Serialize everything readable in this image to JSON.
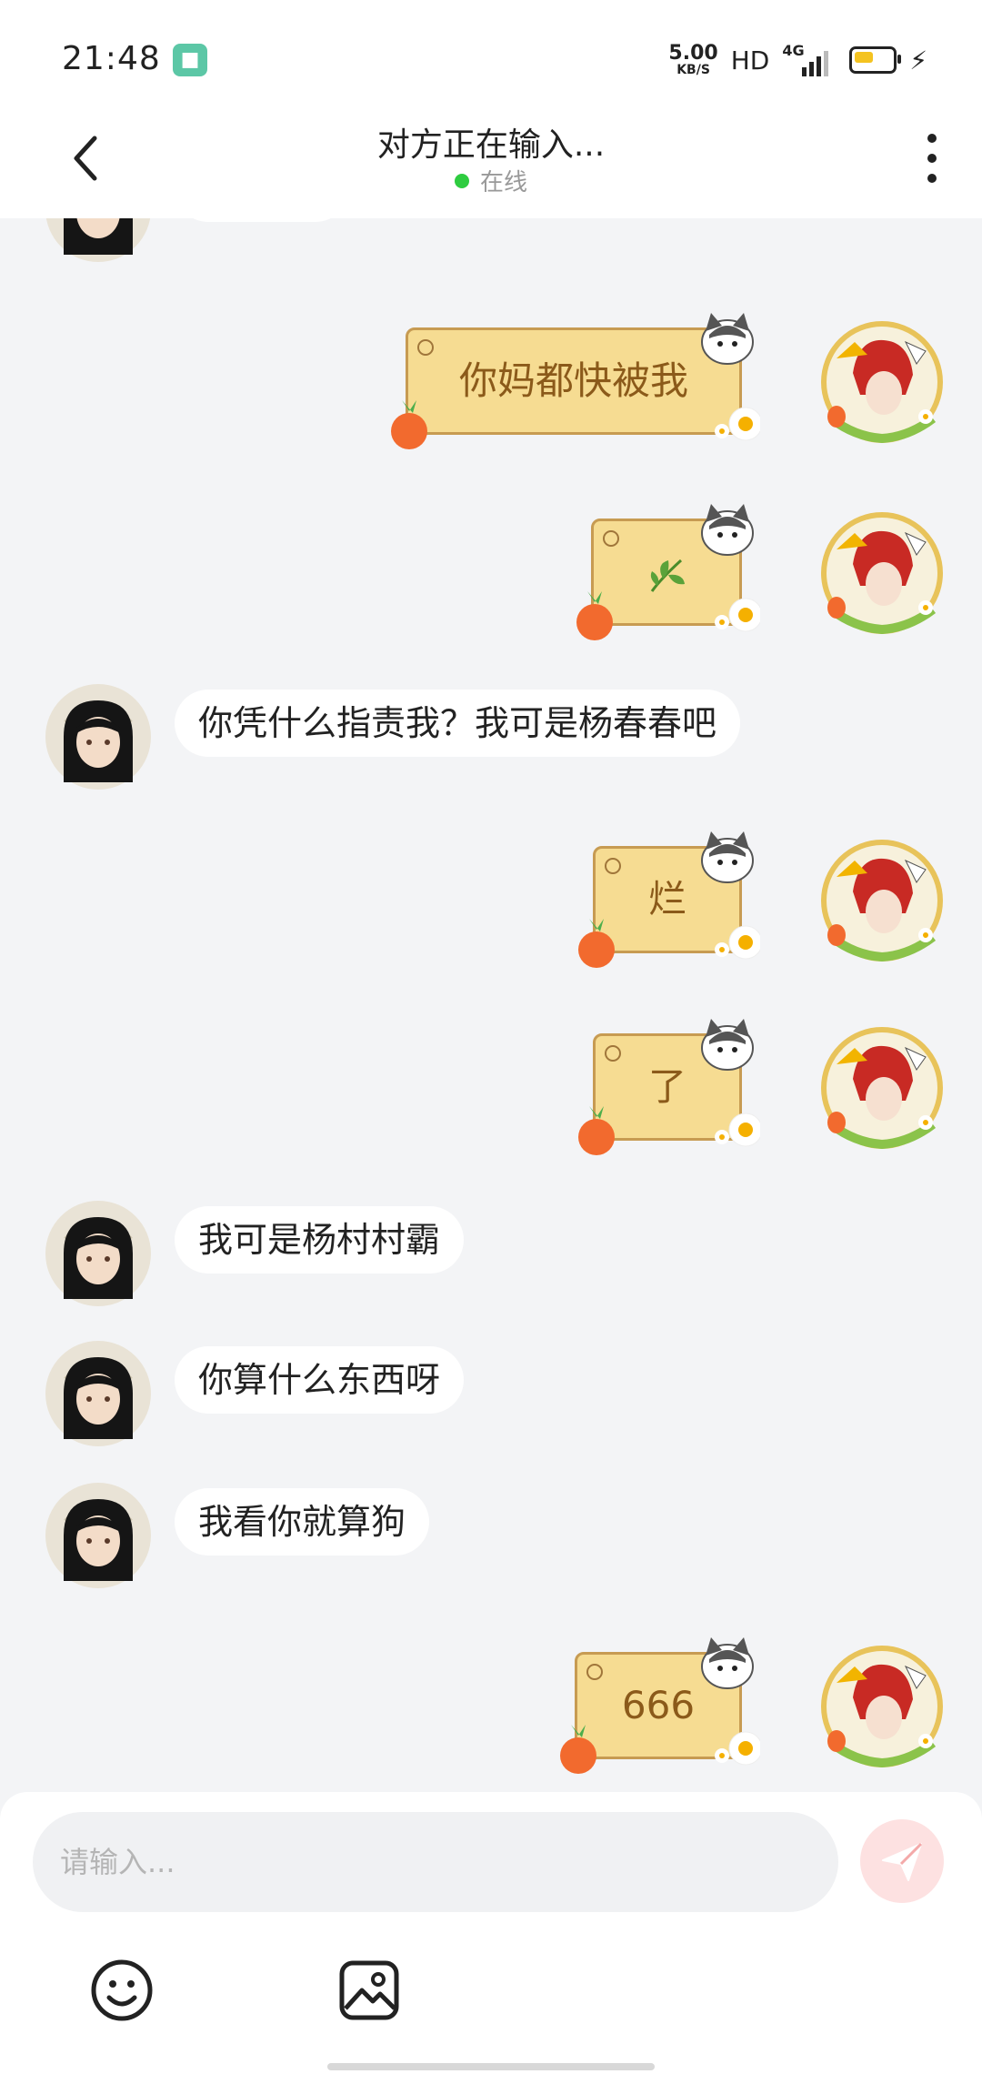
{
  "status_bar": {
    "time": "21:48",
    "net_speed_value": "5.00",
    "net_speed_unit": "KB/S",
    "hd": "HD",
    "network": "4G",
    "battery_level": 0.5,
    "accent_green": "#5cc7a6"
  },
  "header": {
    "title": "对方正在输入...",
    "status": "在线",
    "status_color": "#2ecc40"
  },
  "messages": [
    {
      "side": "left",
      "type": "text",
      "text": ""
    },
    {
      "side": "right",
      "type": "sticker",
      "text": "你妈都快被我"
    },
    {
      "side": "right",
      "type": "sticker",
      "text": "",
      "icon": "leaf-icon"
    },
    {
      "side": "left",
      "type": "text",
      "text": "你凭什么指责我？我可是杨春春吧"
    },
    {
      "side": "right",
      "type": "sticker",
      "text": "烂"
    },
    {
      "side": "right",
      "type": "sticker",
      "text": "了"
    },
    {
      "side": "left",
      "type": "text",
      "text": "我可是杨村村霸"
    },
    {
      "side": "left",
      "type": "text",
      "text": "你算什么东西呀"
    },
    {
      "side": "left",
      "type": "text",
      "text": "我看你就算狗"
    },
    {
      "side": "right",
      "type": "sticker",
      "text": "666"
    }
  ],
  "composer": {
    "placeholder": "请输入...",
    "send_color": "#f47c7c"
  },
  "colors": {
    "sticker_bg": "#f6dc92",
    "sticker_border": "#c79b52",
    "sticker_text": "#8b5a1a",
    "chat_bg": "#f3f4f6"
  }
}
